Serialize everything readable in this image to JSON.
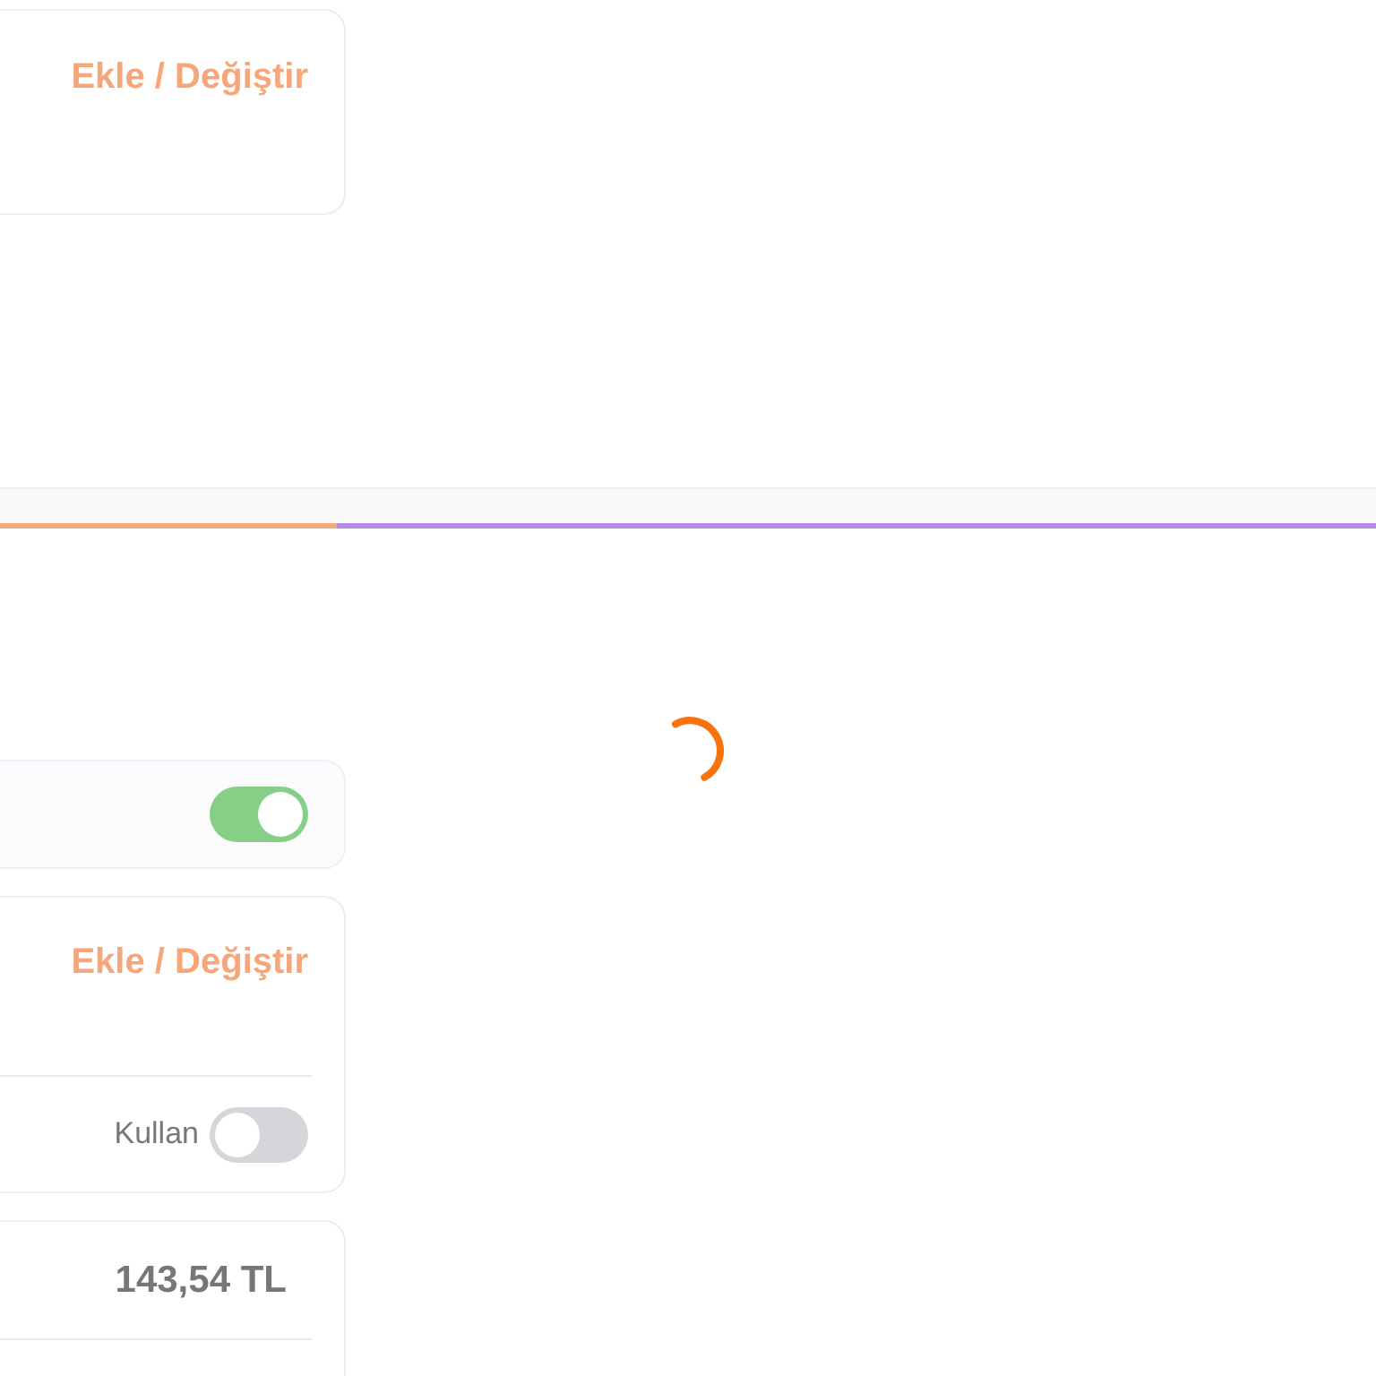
{
  "top_card": {
    "link": "Ekle / Değiştir"
  },
  "progress": {
    "level": 0.245
  },
  "option_card": {
    "on": true
  },
  "address_card": {
    "link": "Ekle / Değiştir",
    "use_label": "Kullan",
    "use_on": false
  },
  "total_card": {
    "amount": "143,54 TL"
  }
}
